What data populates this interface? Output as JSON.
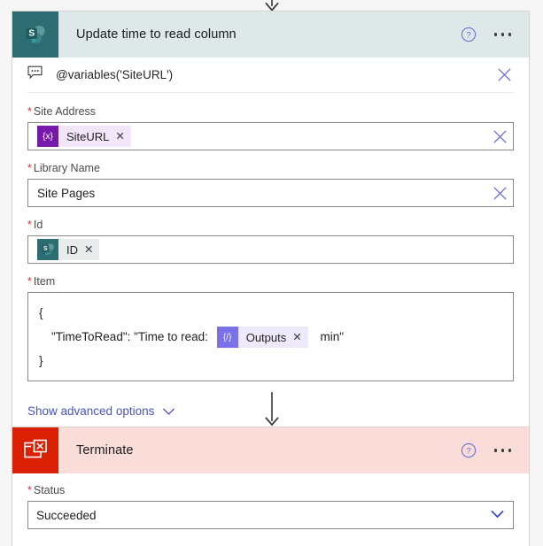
{
  "connectors": {
    "top_arrow": "arrow-down",
    "mid_arrow": "arrow-down"
  },
  "cards": [
    {
      "id": "update-time-to-read-column",
      "title": "Update time to read column",
      "icon": "sharepoint-icon",
      "theme": "sharepoint",
      "help_icon": "help-circle-icon",
      "more_icon": "ellipsis-icon",
      "note": {
        "icon": "comment-icon",
        "text": "@variables('SiteURL')",
        "dismiss_icon": "close-icon"
      },
      "fields": [
        {
          "name": "site-address",
          "label": "Site Address",
          "required": true,
          "type": "token",
          "token": {
            "text": "SiteURL",
            "icon": "variable-icon",
            "glyph": "{x}",
            "kind": "variable",
            "remove_icon": "token-remove-icon"
          },
          "clear_icon": "close-icon"
        },
        {
          "name": "library-name",
          "label": "Library Name",
          "required": true,
          "type": "text",
          "value": "Site Pages",
          "clear_icon": "close-icon"
        },
        {
          "name": "id",
          "label": "Id",
          "required": true,
          "type": "token",
          "token": {
            "text": "ID",
            "icon": "sharepoint-icon",
            "glyph": "",
            "kind": "sharepoint",
            "remove_icon": "token-remove-icon"
          },
          "clear_icon": null
        },
        {
          "name": "item",
          "label": "Item",
          "required": true,
          "type": "code",
          "lines": {
            "open_brace": "{",
            "prefix": "\"TimeToRead\": \"Time to read:",
            "suffix": "min\"",
            "close_brace": "}"
          },
          "token": {
            "text": "Outputs",
            "icon": "compose-icon",
            "glyph": "{/}",
            "kind": "compose",
            "remove_icon": "token-remove-icon"
          }
        }
      ],
      "advanced": {
        "label": "Show advanced options",
        "icon": "chevron-down-icon"
      }
    },
    {
      "id": "terminate",
      "title": "Terminate",
      "icon": "terminate-icon",
      "theme": "terminate",
      "help_icon": "help-circle-icon",
      "more_icon": "ellipsis-icon",
      "fields": [
        {
          "name": "status",
          "label": "Status",
          "required": true,
          "type": "select",
          "value": "Succeeded",
          "chevron_icon": "chevron-down-icon"
        }
      ]
    }
  ],
  "colors": {
    "sharepoint_teal": "#2d6c70",
    "sharepoint_header": "#dee8e9",
    "terminate_red": "#d92003",
    "terminate_header": "#fadcd8",
    "accent_blue": "#4a52c8",
    "required_red": "#d13438",
    "variable_purple": "#7719aa",
    "compose_purple": "#7a70e8"
  }
}
